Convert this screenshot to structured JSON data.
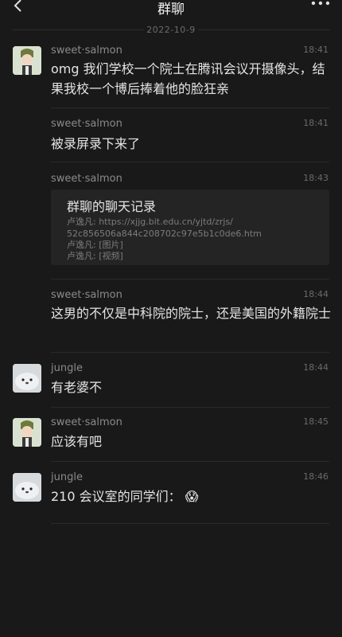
{
  "header": {
    "title": "群聊",
    "back_icon": "chevron-left-icon",
    "more_icon": "ellipsis-icon"
  },
  "date_divider": "2022-10-9",
  "messages": [
    {
      "sender": "sweet·salmon",
      "time": "18:41",
      "text": "omg 我们学校一个院士在腾讯会议开摄像头，结果我校一个博后捧着他的脸狂亲"
    },
    {
      "sender": "sweet·salmon",
      "time": "18:41",
      "text": "被录屏录下来了"
    },
    {
      "sender": "sweet·salmon",
      "time": "18:43",
      "card": {
        "title": "群聊的聊天记录",
        "lines": [
          "卢逸凡: https://xjjg.bit.edu.cn/yjtd/zrjs/",
          "52c856506a844c208702c97e5b1c0de6.htm",
          "卢逸凡: [图片]",
          "卢逸凡: [视频]"
        ]
      }
    },
    {
      "sender": "sweet·salmon",
      "time": "18:44",
      "text": "这男的不仅是中科院的院士，还是美国的外籍院士"
    },
    {
      "sender": "jungle",
      "time": "18:44",
      "text": "有老婆不"
    },
    {
      "sender": "sweet·salmon",
      "time": "18:45",
      "text": "应该有吧"
    },
    {
      "sender": "jungle",
      "time": "18:46",
      "text": "210 会议室的同学们：",
      "emoji": "😱"
    }
  ],
  "colors": {
    "background": "#191919",
    "text": "#e4e4e4",
    "muted": "#8a8a8a",
    "card": "#242424"
  }
}
